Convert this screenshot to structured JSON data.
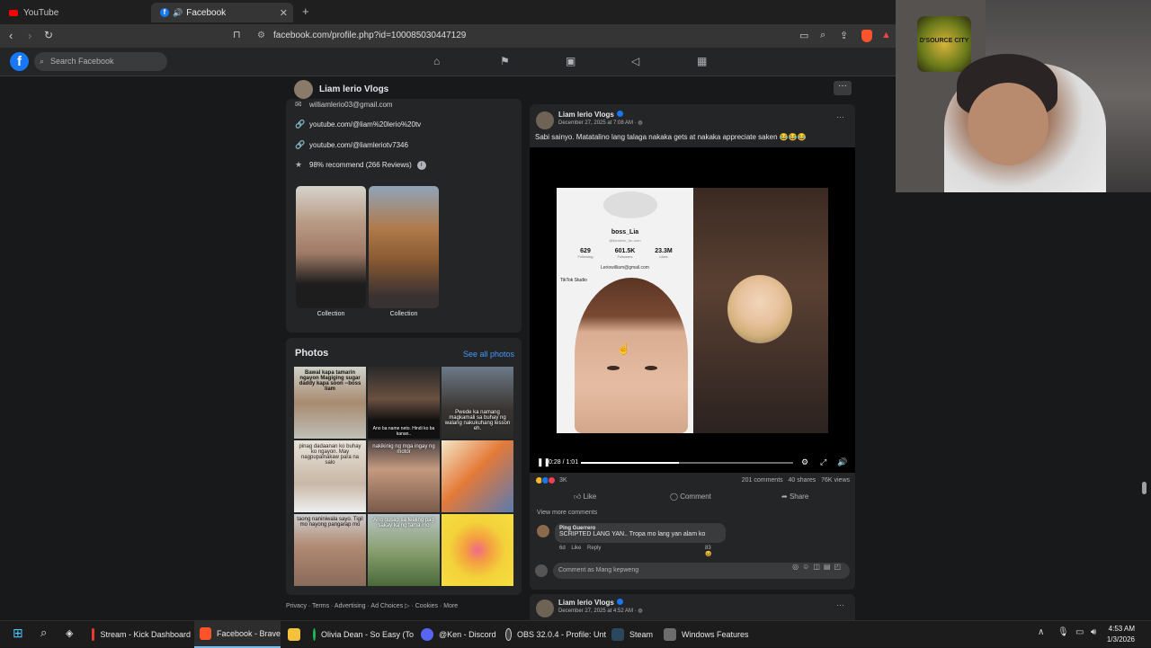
{
  "browser": {
    "tabs": [
      {
        "label": "YouTube"
      },
      {
        "label": "Facebook"
      }
    ],
    "url": "facebook.com/profile.php?id=100085030447129"
  },
  "facebook": {
    "logo": "f",
    "search_placeholder": "Search Facebook"
  },
  "profile": {
    "name": "Liam lerio Vlogs",
    "more_label": "···"
  },
  "intro": {
    "email": "williamlerio03@gmail.com",
    "links": [
      "youtube.com/@liam%20lerio%20tv",
      "youtube.com/@liamleriotv7346"
    ],
    "recommend": "98% recommend (266 Reviews)",
    "collections": [
      {
        "label": "Collection"
      },
      {
        "label": "Collection"
      }
    ]
  },
  "photos": {
    "title": "Photos",
    "see_all": "See all photos",
    "captions": [
      "Bawal kapa tamarin ngayon Magiging sugar daddy kapa soon --boss liam",
      "Ano ba name neto. Hindi ko ba kanan..",
      "Pwede ka namang magkamali sa buhay ng walang nakukuhang lesson eh.",
      "pinag dadaanan ko buhay ko ngayon. May nagpupalnakaw para na salo",
      "nakikinig ng mga ingay ng motor",
      "",
      "taong naniniwala sayo. Tigil mo nayong pangarap mo",
      "Ang gusap sa feeling pag sakay ka ng tama mo",
      ""
    ]
  },
  "footer": "Privacy · Terms · Advertising · Ad Choices ▷ · Cookies · More",
  "post": {
    "author": "Liam lerio Vlogs",
    "date": "December 27, 2025 at 7:08 AM · ",
    "caption": "Sabi sainyo. Matatalino lang talaga nakaka gets at nakaka appreciate saken 😂😂😂",
    "video": {
      "tiktok_name": "boss_Lia",
      "tiktok_handle": "@liamlerio_tiu..com",
      "stats": [
        {
          "value": "629",
          "label": "Following"
        },
        {
          "value": "601.5K",
          "label": "Followers"
        },
        {
          "value": "23.3M",
          "label": "Likes"
        }
      ],
      "tiktok_email": "Leriowilliam@gmail.com",
      "tiktok_studio": "TikTok Studio",
      "time": "0:28 / 1:01",
      "progress": 0.46
    },
    "reactions_count": "3K",
    "comments_count": "201 comments",
    "shares_count": "40 shares",
    "views_count": "76K views",
    "actions": {
      "like": "Like",
      "comment": "Comment",
      "share": "Share"
    },
    "view_more": "View more comments",
    "comment": {
      "name": "Ping Guerrero",
      "text": "SCRIPTED LANG YAN.. Tropa mo lang yan alam ko",
      "time": "6d",
      "like": "Like",
      "reply": "Reply",
      "react_count": "83"
    },
    "comment_placeholder": "Comment as Mang kepweng"
  },
  "post2": {
    "author": "Liam lerio Vlogs",
    "date": "December 27, 2025 at 4:52 AM · "
  },
  "webcam": {
    "logo_text": "D'SOURCE CITY"
  },
  "taskbar": {
    "items": [
      {
        "label": "Stream - Kick Dashboard",
        "color": "#e43d2f"
      },
      {
        "label": "Facebook - Brave",
        "color": "#fb542b"
      },
      {
        "label": "",
        "color": "#f3c13a"
      },
      {
        "label": "Olivia Dean - So Easy (To",
        "color": "#1db954"
      },
      {
        "label": "@Ken - Discord",
        "color": "#5865f2"
      },
      {
        "label": "OBS 32.0.4 - Profile: Unt",
        "color": "#444444"
      },
      {
        "label": "Steam",
        "color": "#1b2838"
      },
      {
        "label": "Windows Features",
        "color": "#6d6d6d"
      }
    ],
    "time": "4:53 AM",
    "date": "1/3/2026"
  }
}
